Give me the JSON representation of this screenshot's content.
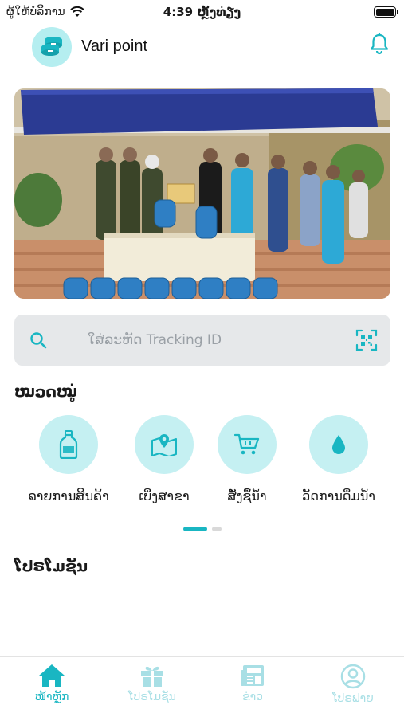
{
  "status_bar": {
    "carrier": "ຜູ້ໃຫ້ບໍລິການ",
    "time": "4:39 ຫຼັງທ່ຽງ"
  },
  "header": {
    "title": "Vari point",
    "logo_icon": "water-bottles-icon",
    "notification_icon": "bell-icon"
  },
  "search": {
    "placeholder": "ໃສ່ລະຫັດ Tracking ID",
    "search_icon": "search-icon",
    "scan_icon": "qr-scan-icon"
  },
  "categories": {
    "title": "ໝວດໝູ່",
    "items": [
      {
        "label": "ລາຍການສິນຄ້າ",
        "icon": "bottle-icon"
      },
      {
        "label": "ເບິ່ງສາຂາ",
        "icon": "map-pin-icon"
      },
      {
        "label": "ສັ່ງຊື້ນໍ້າ",
        "icon": "cart-icon"
      },
      {
        "label": "ວັດການດື່ມນໍ້າ",
        "icon": "water-drop-icon"
      }
    ]
  },
  "promotions": {
    "title": "ໂປຣໂມຊັນ"
  },
  "bottom_nav": {
    "items": [
      {
        "label": "ໜ້າຫຼັກ",
        "icon": "home-icon",
        "active": true
      },
      {
        "label": "ໂປຣໂມຊັນ",
        "icon": "gift-icon",
        "active": false
      },
      {
        "label": "ຂ່າວ",
        "icon": "news-icon",
        "active": false
      },
      {
        "label": "ໂປຣຟາຍ",
        "icon": "profile-icon",
        "active": false
      }
    ]
  },
  "colors": {
    "accent": "#19b6c2",
    "icon_circle": "#c5f0f2",
    "inactive": "#a8dfe5"
  }
}
